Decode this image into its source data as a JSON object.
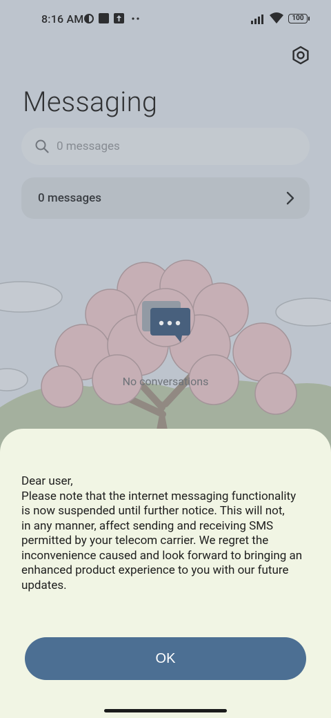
{
  "status_bar": {
    "time": "8:16 AM",
    "battery": "100",
    "icons": [
      "dnd-icon",
      "square-icon",
      "upload-icon",
      "more-dots-icon",
      "signal-icon",
      "wifi-icon",
      "battery-icon"
    ]
  },
  "header": {
    "title": "Messaging",
    "settings_icon": "settings-icon"
  },
  "search": {
    "placeholder": "0 messages",
    "icon": "search-icon"
  },
  "summary_card": {
    "label": "0 messages",
    "icon": "chevron-right-icon"
  },
  "empty_state": {
    "icon": "chat-bubble-icon",
    "text": "No conversations"
  },
  "dialog": {
    "greeting": "Dear user,",
    "body": "Please note that the internet messaging functionality\nis now suspended until further notice. This will not,\nin any manner, affect sending and receiving SMS\npermitted by your telecom carrier. We regret the\ninconvenience caused and look forward to bringing an\nenhanced product experience to you with our future\nupdates.",
    "ok_label": "OK"
  },
  "colors": {
    "sheet_bg": "#f1f5e4",
    "button_bg": "#4c6f93",
    "chat_icon": "#3d5a7a"
  }
}
